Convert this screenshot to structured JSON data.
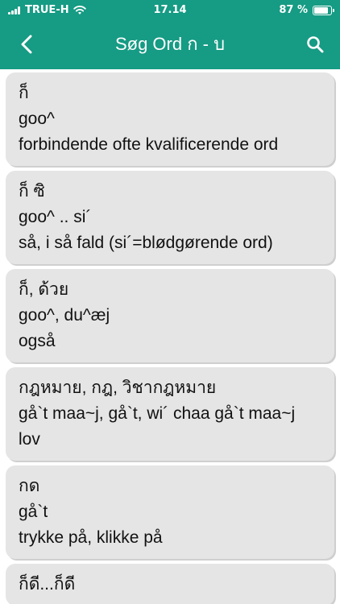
{
  "status_bar": {
    "carrier": "TRUE-H",
    "time": "17.14",
    "battery_text": "87 %",
    "battery_level": 0.87
  },
  "header": {
    "title": "Søg Ord ก - บ",
    "background": "#169b84"
  },
  "entries": [
    {
      "thai": "ก็",
      "romanization": "goo^",
      "meaning": "forbindende ofte kvalificerende ord"
    },
    {
      "thai": "ก็ ซิ",
      "romanization": "goo^ .. si´",
      "meaning": "så, i så fald (si´=blødgørende ord)"
    },
    {
      "thai": "ก็, ด้วย",
      "romanization": "goo^, du^æj",
      "meaning": "også"
    },
    {
      "thai": "กฎหมาย, กฎ, วิชากฎหมาย",
      "romanization": "gå`t maa~j, gå`t, wi´ chaa gå`t maa~j",
      "meaning": "lov"
    },
    {
      "thai": "กด",
      "romanization": "gå`t",
      "meaning": "trykke på, klikke på"
    },
    {
      "thai": "ก็ดี...ก็ดี",
      "romanization": "",
      "meaning": ""
    }
  ]
}
